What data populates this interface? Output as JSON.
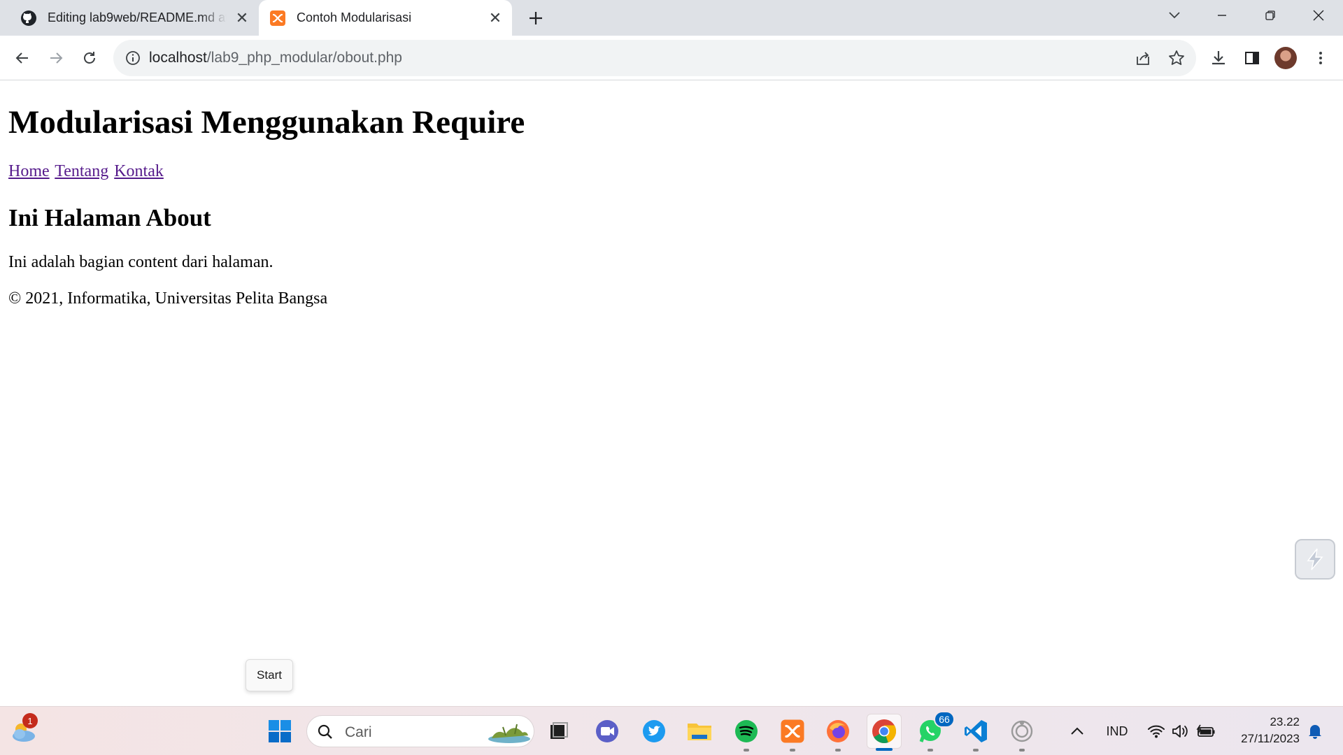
{
  "browser": {
    "tabs": [
      {
        "title": "Editing lab9web/README.md at",
        "favicon": "github-icon",
        "active": false
      },
      {
        "title": "Contoh Modularisasi",
        "favicon": "xampp-icon",
        "active": true
      }
    ],
    "address_bar": {
      "host": "localhost",
      "path": "/lab9_php_modular/obout.php"
    }
  },
  "page": {
    "heading": "Modularisasi Menggunakan Require",
    "nav": [
      "Home",
      "Tentang",
      "Kontak"
    ],
    "subheading": "Ini Halaman About",
    "content": "Ini adalah bagian content dari halaman.",
    "footer": "© 2021, Informatika, Universitas Pelita Bangsa"
  },
  "tooltip": {
    "text": "Start"
  },
  "taskbar": {
    "weather_badge": "1",
    "search_placeholder": "Cari",
    "apps": [
      "start-icon",
      "task-view-icon",
      "meet-icon",
      "twitter-icon",
      "file-explorer-icon",
      "spotify-icon",
      "xampp-icon",
      "firefox-icon",
      "chrome-icon",
      "whatsapp-icon",
      "vscode-icon",
      "obs-icon"
    ],
    "whatsapp_badge": "66",
    "language": "IND",
    "time": "23.22",
    "date": "27/11/2023"
  },
  "colors": {
    "link_visited": "#551a8b",
    "tab_strip": "#dee1e6",
    "accent": "#0067c0"
  }
}
